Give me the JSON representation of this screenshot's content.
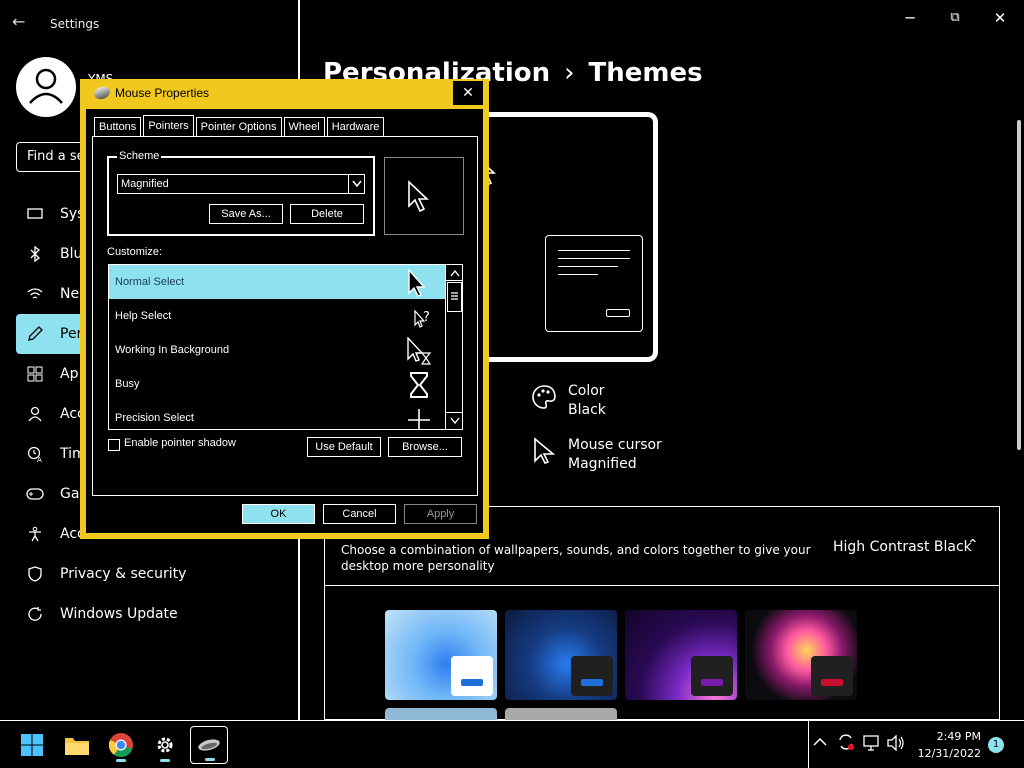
{
  "window": {
    "title": "Settings",
    "back_glyph": "←",
    "minimize_glyph": "─",
    "restore_glyph": "⧉",
    "close_glyph": "✕"
  },
  "user": {
    "name": "YMS"
  },
  "search": {
    "value": "Find a se"
  },
  "sidebar": {
    "items": [
      {
        "label": "Sys",
        "icon": "system-icon"
      },
      {
        "label": "Blu",
        "icon": "bluetooth-icon"
      },
      {
        "label": "Ne",
        "icon": "wifi-icon"
      },
      {
        "label": "Per",
        "icon": "pen-icon",
        "active": true
      },
      {
        "label": "Ap",
        "icon": "apps-icon"
      },
      {
        "label": "Acc",
        "icon": "accounts-icon"
      },
      {
        "label": "Tim",
        "icon": "time-language-icon"
      },
      {
        "label": "Ga",
        "icon": "gaming-icon"
      },
      {
        "label": "Acc",
        "icon": "accessibility-icon"
      },
      {
        "label": "Privacy & security",
        "icon": "shield-icon"
      },
      {
        "label": "Windows Update",
        "icon": "update-icon"
      }
    ]
  },
  "page": {
    "breadcrumb_parent": "Personalization",
    "breadcrumb_sep": "›",
    "breadcrumb_current": "Themes"
  },
  "theme_info": {
    "color_label": "Color",
    "color_value": "Black",
    "cursor_label": "Mouse cursor",
    "cursor_value": "Magnified"
  },
  "themes_panel": {
    "description": "Choose a combination of wallpapers, sounds, and colors together to give your desktop more personality",
    "current": "High Contrast Black",
    "chevron": "⌃",
    "thumbnails": [
      {
        "name": "theme-light",
        "bar": "#1e6fd9",
        "card": "#ffffff"
      },
      {
        "name": "theme-dark",
        "bar": "#1e6fd9",
        "card": "#202020"
      },
      {
        "name": "theme-glow",
        "bar": "#7a1aa8",
        "card": "#202020"
      },
      {
        "name": "theme-flower",
        "bar": "#c8102e",
        "card": "#202020"
      }
    ]
  },
  "dialog": {
    "title": "Mouse Properties",
    "close_glyph": "✕",
    "tabs": [
      "Buttons",
      "Pointers",
      "Pointer Options",
      "Wheel",
      "Hardware"
    ],
    "active_tab": "Pointers",
    "scheme_legend": "Scheme",
    "scheme_value": "Magnified",
    "save_as_label": "Save As...",
    "delete_label": "Delete",
    "customize_label": "Customize:",
    "cursor_rows": [
      {
        "label": "Normal Select",
        "selected": true,
        "icon": "arrow-cursor-icon"
      },
      {
        "label": "Help Select",
        "selected": false,
        "icon": "help-cursor-icon"
      },
      {
        "label": "Working In Background",
        "selected": false,
        "icon": "working-cursor-icon"
      },
      {
        "label": "Busy",
        "selected": false,
        "icon": "busy-cursor-icon"
      },
      {
        "label": "Precision Select",
        "selected": false,
        "icon": "precision-cursor-icon"
      }
    ],
    "shadow_label": "Enable pointer shadow",
    "use_default_label": "Use Default",
    "browse_label": "Browse...",
    "ok_label": "OK",
    "cancel_label": "Cancel",
    "apply_label": "Apply"
  },
  "taskbar": {
    "time": "2:49 PM",
    "date": "12/31/2022",
    "notifications": "1"
  },
  "colors": {
    "accent": "#8ee2f0",
    "dialog_frame": "#f0c81e",
    "background": "#000000"
  }
}
